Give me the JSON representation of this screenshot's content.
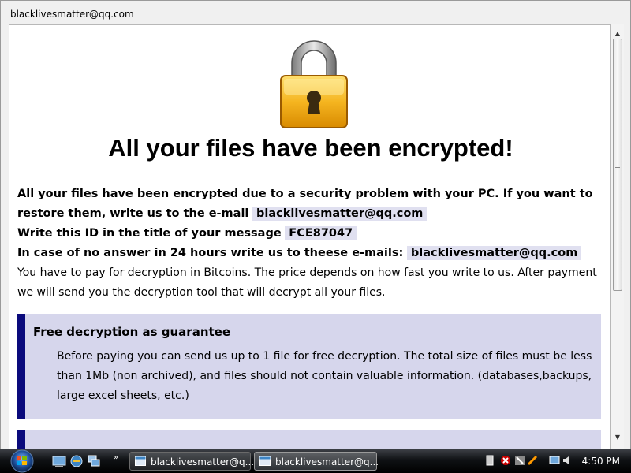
{
  "window": {
    "title": "blacklivesmatter@qq.com"
  },
  "note": {
    "headline": "All your files have been encrypted!",
    "line1_a": "All your files have been encrypted due to a security problem with your PC. If you want to restore them, write us to the e-mail",
    "line1_email": "blacklivesmatter@qq.com",
    "line2_a": "Write this ID in the title of your message",
    "line2_id": "FCE87047",
    "line3_a": "In case of no answer in 24 hours write us to theese e-mails:",
    "line3_email": "blacklivesmatter@qq.com",
    "payment_text": "You have to pay for decryption in Bitcoins. The price depends on how fast you write to us. After payment we will send you the decryption tool that will decrypt all your files.",
    "guarantee_title": "Free decryption as guarantee",
    "guarantee_text": "Before paying you can send us up to 1 file for free decryption. The total size of files must be less than 1Mb (non archived), and files should not contain valuable information. (databases,backups, large excel sheets, etc.)"
  },
  "taskbar": {
    "quicklaunch_more": "»",
    "tasks": [
      {
        "label": "blacklivesmatter@q...",
        "active": false
      },
      {
        "label": "blacklivesmatter@q...",
        "active": true
      }
    ],
    "clock": "4:50 PM"
  },
  "colors": {
    "highlight": "#e0e0f0",
    "box_bg": "#d6d6ec",
    "box_border": "#0a0a7c",
    "lock_body": "#f0b020"
  },
  "icons": {
    "lock": "lock-icon",
    "start": "windows-start-icon",
    "scroll_up": "chevron-up-icon",
    "scroll_down": "chevron-down-icon"
  }
}
